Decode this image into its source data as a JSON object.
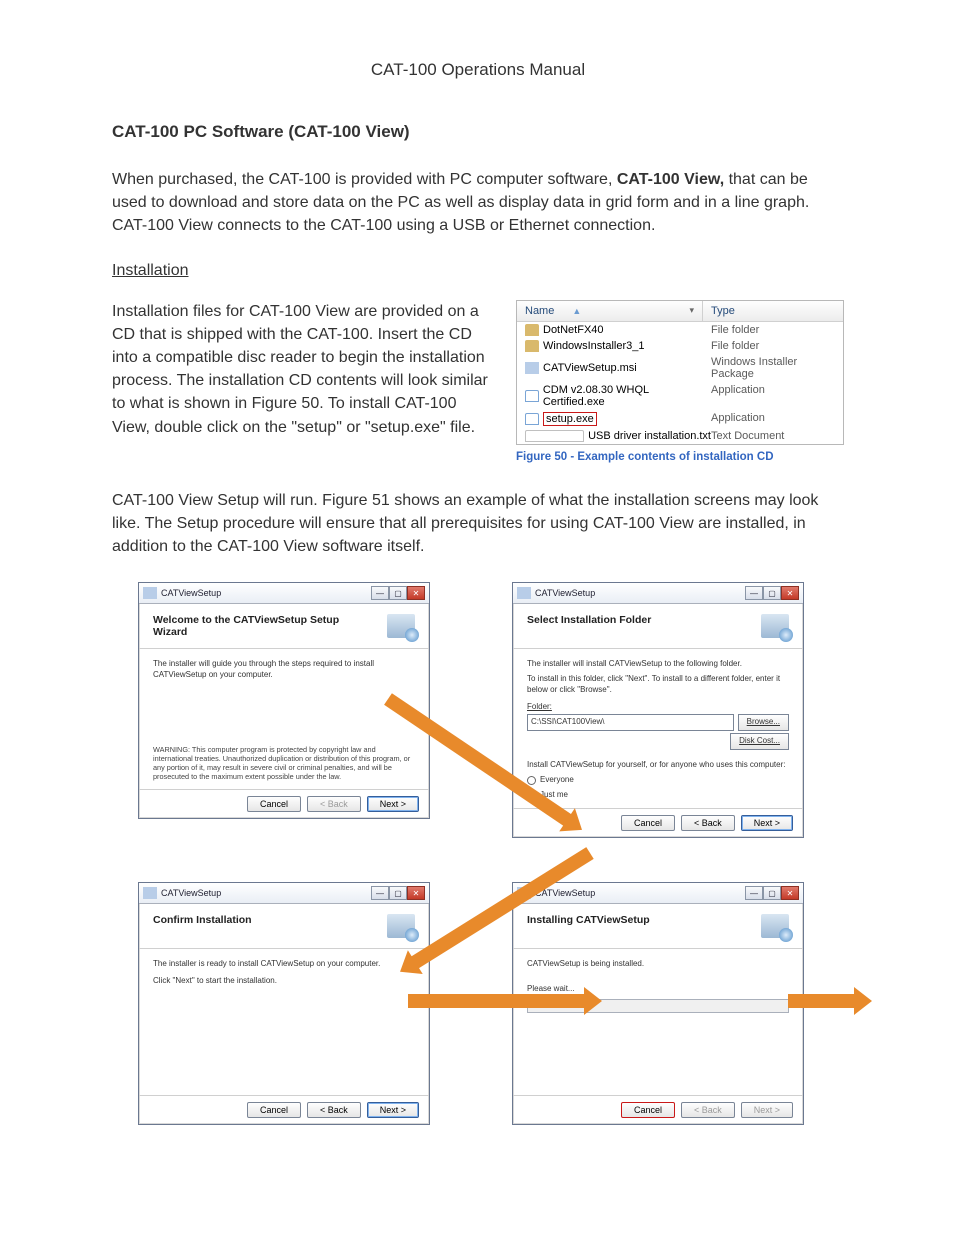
{
  "doc_title": "CAT-100 Operations Manual",
  "section_title": "CAT-100 PC Software (CAT-100 View)",
  "p1_pre": "When purchased, the CAT-100 is provided with PC computer software, ",
  "p1_bold": "CAT-100 View,",
  "p1_post": " that can be used to download and store data on the PC as well as display data in grid form and in a line graph. CAT-100 View connects to the CAT-100 using a USB or Ethernet connection.",
  "h_install": "Installation",
  "p2": "Installation files for CAT-100 View are provided on a CD that is shipped with the CAT-100. Insert the CD into a compatible disc reader to begin the installation process. The installation CD contents will look similar to what is shown in Figure 50. To install CAT-100 View, double click on the \"setup\" or \"setup.exe\" file.",
  "explorer": {
    "col_name": "Name",
    "col_type": "Type",
    "rows": [
      {
        "name": "DotNetFX40",
        "type": "File folder",
        "ico": "fld"
      },
      {
        "name": "WindowsInstaller3_1",
        "type": "File folder",
        "ico": "fld"
      },
      {
        "name": "CATViewSetup.msi",
        "type": "Windows Installer Package",
        "ico": "msi"
      },
      {
        "name": "CDM v2.08.30 WHQL Certified.exe",
        "type": "Application",
        "ico": "exe"
      },
      {
        "name": "setup.exe",
        "type": "Application",
        "ico": "exe",
        "hl": true
      },
      {
        "name": "USB driver installation.txt",
        "type": "Text Document",
        "ico": "txt"
      }
    ]
  },
  "fig50": "Figure 50 - Example contents of installation CD",
  "p3": "CAT-100 View Setup will run. Figure 51 shows an example of what the installation screens may look like. The Setup procedure will ensure that all prerequisites for using CAT-100 View are installed, in addition to the CAT-100 View software itself.",
  "wiz_title": "CATViewSetup",
  "w1": {
    "head": "Welcome to the CATViewSetup Setup Wizard",
    "body": "The installer will guide you through the steps required to install CATViewSetup on your computer.",
    "warn": "WARNING: This computer program is protected by copyright law and international treaties. Unauthorized duplication or distribution of this program, or any portion of it, may result in severe civil or criminal penalties, and will be prosecuted to the maximum extent possible under the law."
  },
  "w2": {
    "head": "Select Installation Folder",
    "l1": "The installer will install CATViewSetup to the following folder.",
    "l2": "To install in this folder, click \"Next\". To install to a different folder, enter it below or click \"Browse\".",
    "folder_lbl": "Folder:",
    "folder_val": "C:\\SSI\\CAT100View\\",
    "browse": "Browse...",
    "diskcost": "Disk Cost...",
    "q": "Install CATViewSetup for yourself, or for anyone who uses this computer:",
    "opt1": "Everyone",
    "opt2": "Just me"
  },
  "w3": {
    "head": "Confirm Installation",
    "l1": "The installer is ready to install CATViewSetup on your computer.",
    "l2": "Click \"Next\" to start the installation."
  },
  "w4": {
    "head": "Installing CATViewSetup",
    "l1": "CATViewSetup is being installed.",
    "l2": "Please wait..."
  },
  "btns": {
    "cancel": "Cancel",
    "back": "< Back",
    "next": "Next >"
  }
}
